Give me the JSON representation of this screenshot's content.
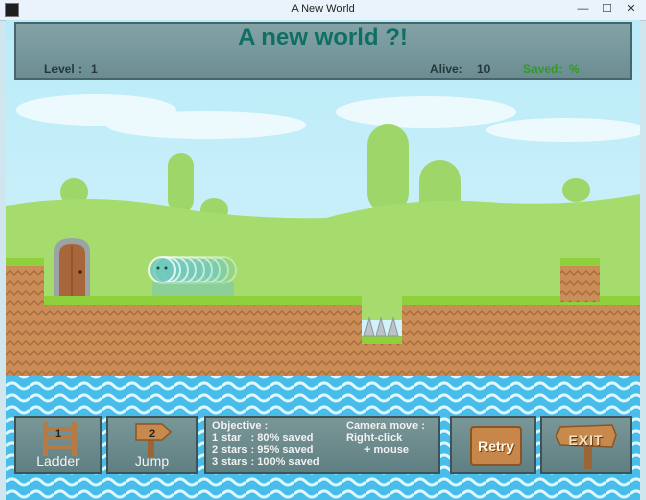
{
  "window": {
    "title": "A New World",
    "minimize_glyph": "—",
    "maximize_glyph": "☐",
    "close_glyph": "✕"
  },
  "hud": {
    "level_title": "A new world ?!",
    "level_label": "Level :",
    "level_value": "1",
    "alive_label": "Alive:",
    "alive_value": "10",
    "saved_label": "Saved:",
    "saved_value": "%"
  },
  "skills": [
    {
      "label": "Ladder",
      "count": "1",
      "icon": "ladder-icon"
    },
    {
      "label": "Jump",
      "count": "2",
      "icon": "arrow-sign-icon"
    }
  ],
  "objective": {
    "heading": "Objective :",
    "lines": [
      "1 star   : 80% saved",
      "2 stars : 95% saved",
      "3 stars : 100% saved"
    ]
  },
  "camera": {
    "heading": "Camera move :",
    "lines": [
      "Right-click",
      "+ mouse"
    ]
  },
  "buttons": {
    "retry": "Retry",
    "exit": "EXIT"
  },
  "colors": {
    "hud_title": "#0f6f62",
    "saved_text": "#2f9b22",
    "grass": "#8ed13c",
    "sky": "#c9eef8",
    "water": "#35b7e7"
  }
}
